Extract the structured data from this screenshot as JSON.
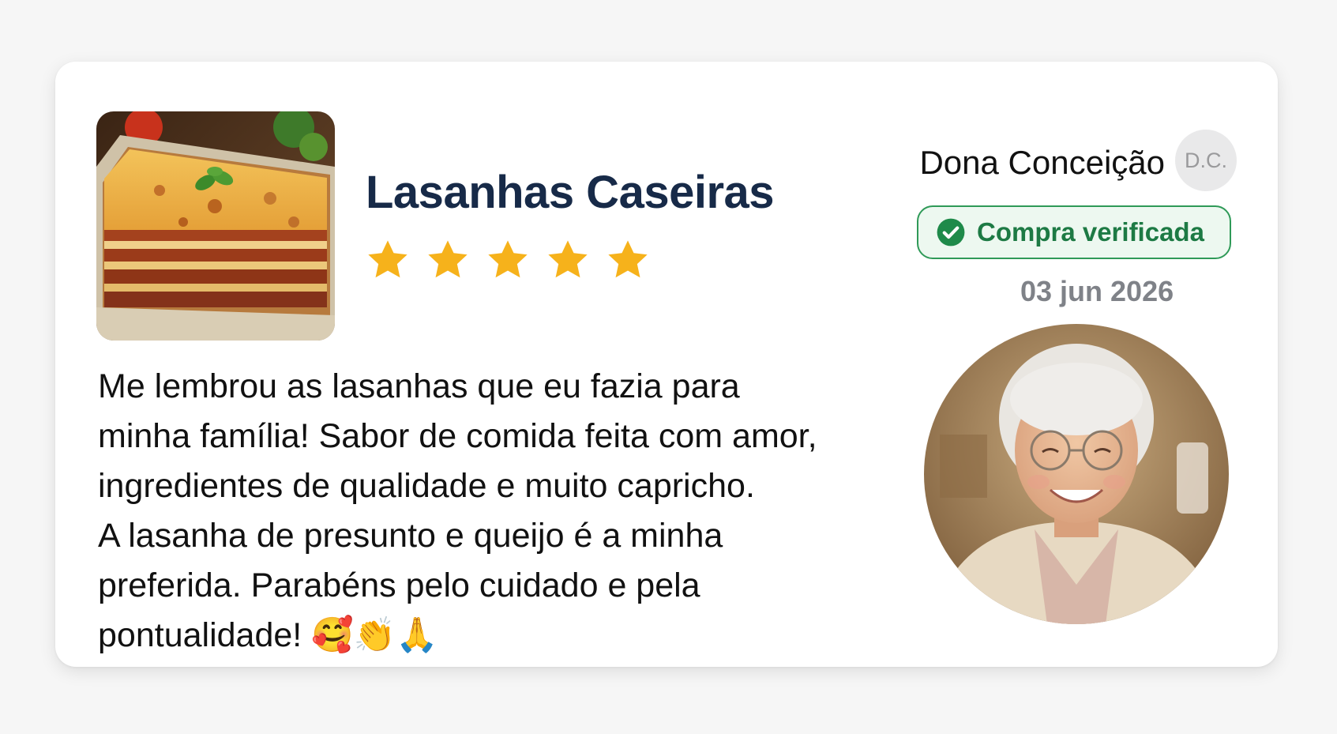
{
  "product": {
    "title": "Lasanhas Caseiras",
    "image_icon": "lasagna-photo",
    "rating": 5,
    "rating_max": 5,
    "star_color": "#f6b21b"
  },
  "review": {
    "text": "Me lembrou as lasanhas que eu fazia para\nminha família! Sabor de comida feita com amor,\ningredientes de qualidade e muito capricho.\nA lasanha de presunto e queijo é a minha\npreferida. Parabéns pelo cuidado e pela\npontualidade! 🥰👏🙏"
  },
  "reviewer": {
    "name": "Dona Conceição",
    "initials": "D.C.",
    "photo_icon": "elderly-woman-photo"
  },
  "verification": {
    "label": "Compra verificada",
    "icon": "check-circle-icon",
    "color": "#2f9a58"
  },
  "date": "03 jun 2026"
}
